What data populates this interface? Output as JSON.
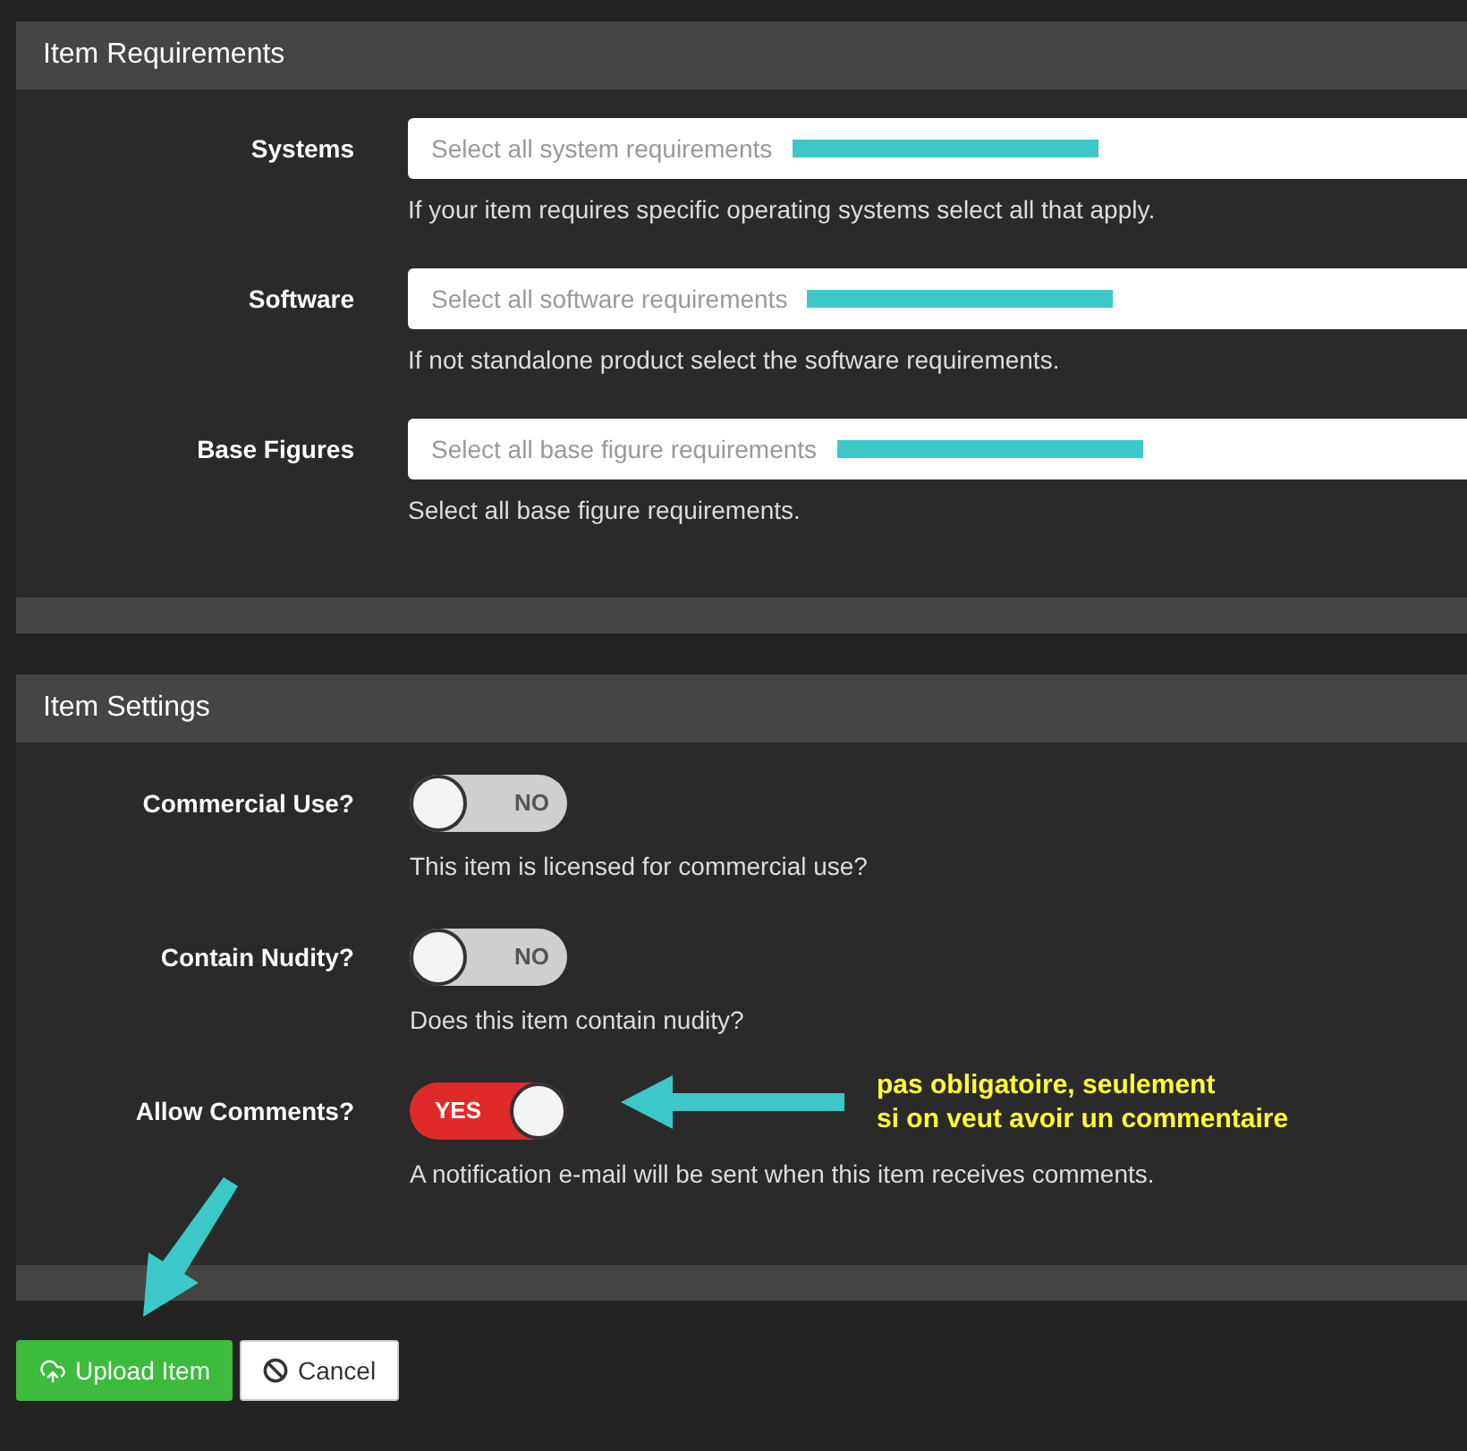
{
  "requirements": {
    "title": "Item Requirements",
    "fields": [
      {
        "label": "Systems",
        "placeholder": "Select all system requirements",
        "help": "If your item requires specific operating systems select all that apply."
      },
      {
        "label": "Software",
        "placeholder": "Select all software requirements",
        "help": "If not standalone product select the software requirements."
      },
      {
        "label": "Base Figures",
        "placeholder": "Select all base figure requirements",
        "help": "Select all base figure requirements."
      }
    ]
  },
  "settings": {
    "title": "Item Settings",
    "fields": [
      {
        "label": "Commercial Use?",
        "on": false,
        "state_text": "NO",
        "help": "This item is licensed for commercial use?"
      },
      {
        "label": "Contain Nudity?",
        "on": false,
        "state_text": "NO",
        "help": "Does this item contain nudity?"
      },
      {
        "label": "Allow Comments?",
        "on": true,
        "state_text": "YES",
        "help": "A notification e-mail will be sent when this item receives comments."
      }
    ]
  },
  "annotation": {
    "lines": [
      "pas obligatoire, seulement",
      "si on veut avoir un commentaire"
    ]
  },
  "buttons": [
    {
      "kind": "primary",
      "label": "Upload Item"
    },
    {
      "kind": "secondary",
      "label": "Cancel"
    }
  ]
}
